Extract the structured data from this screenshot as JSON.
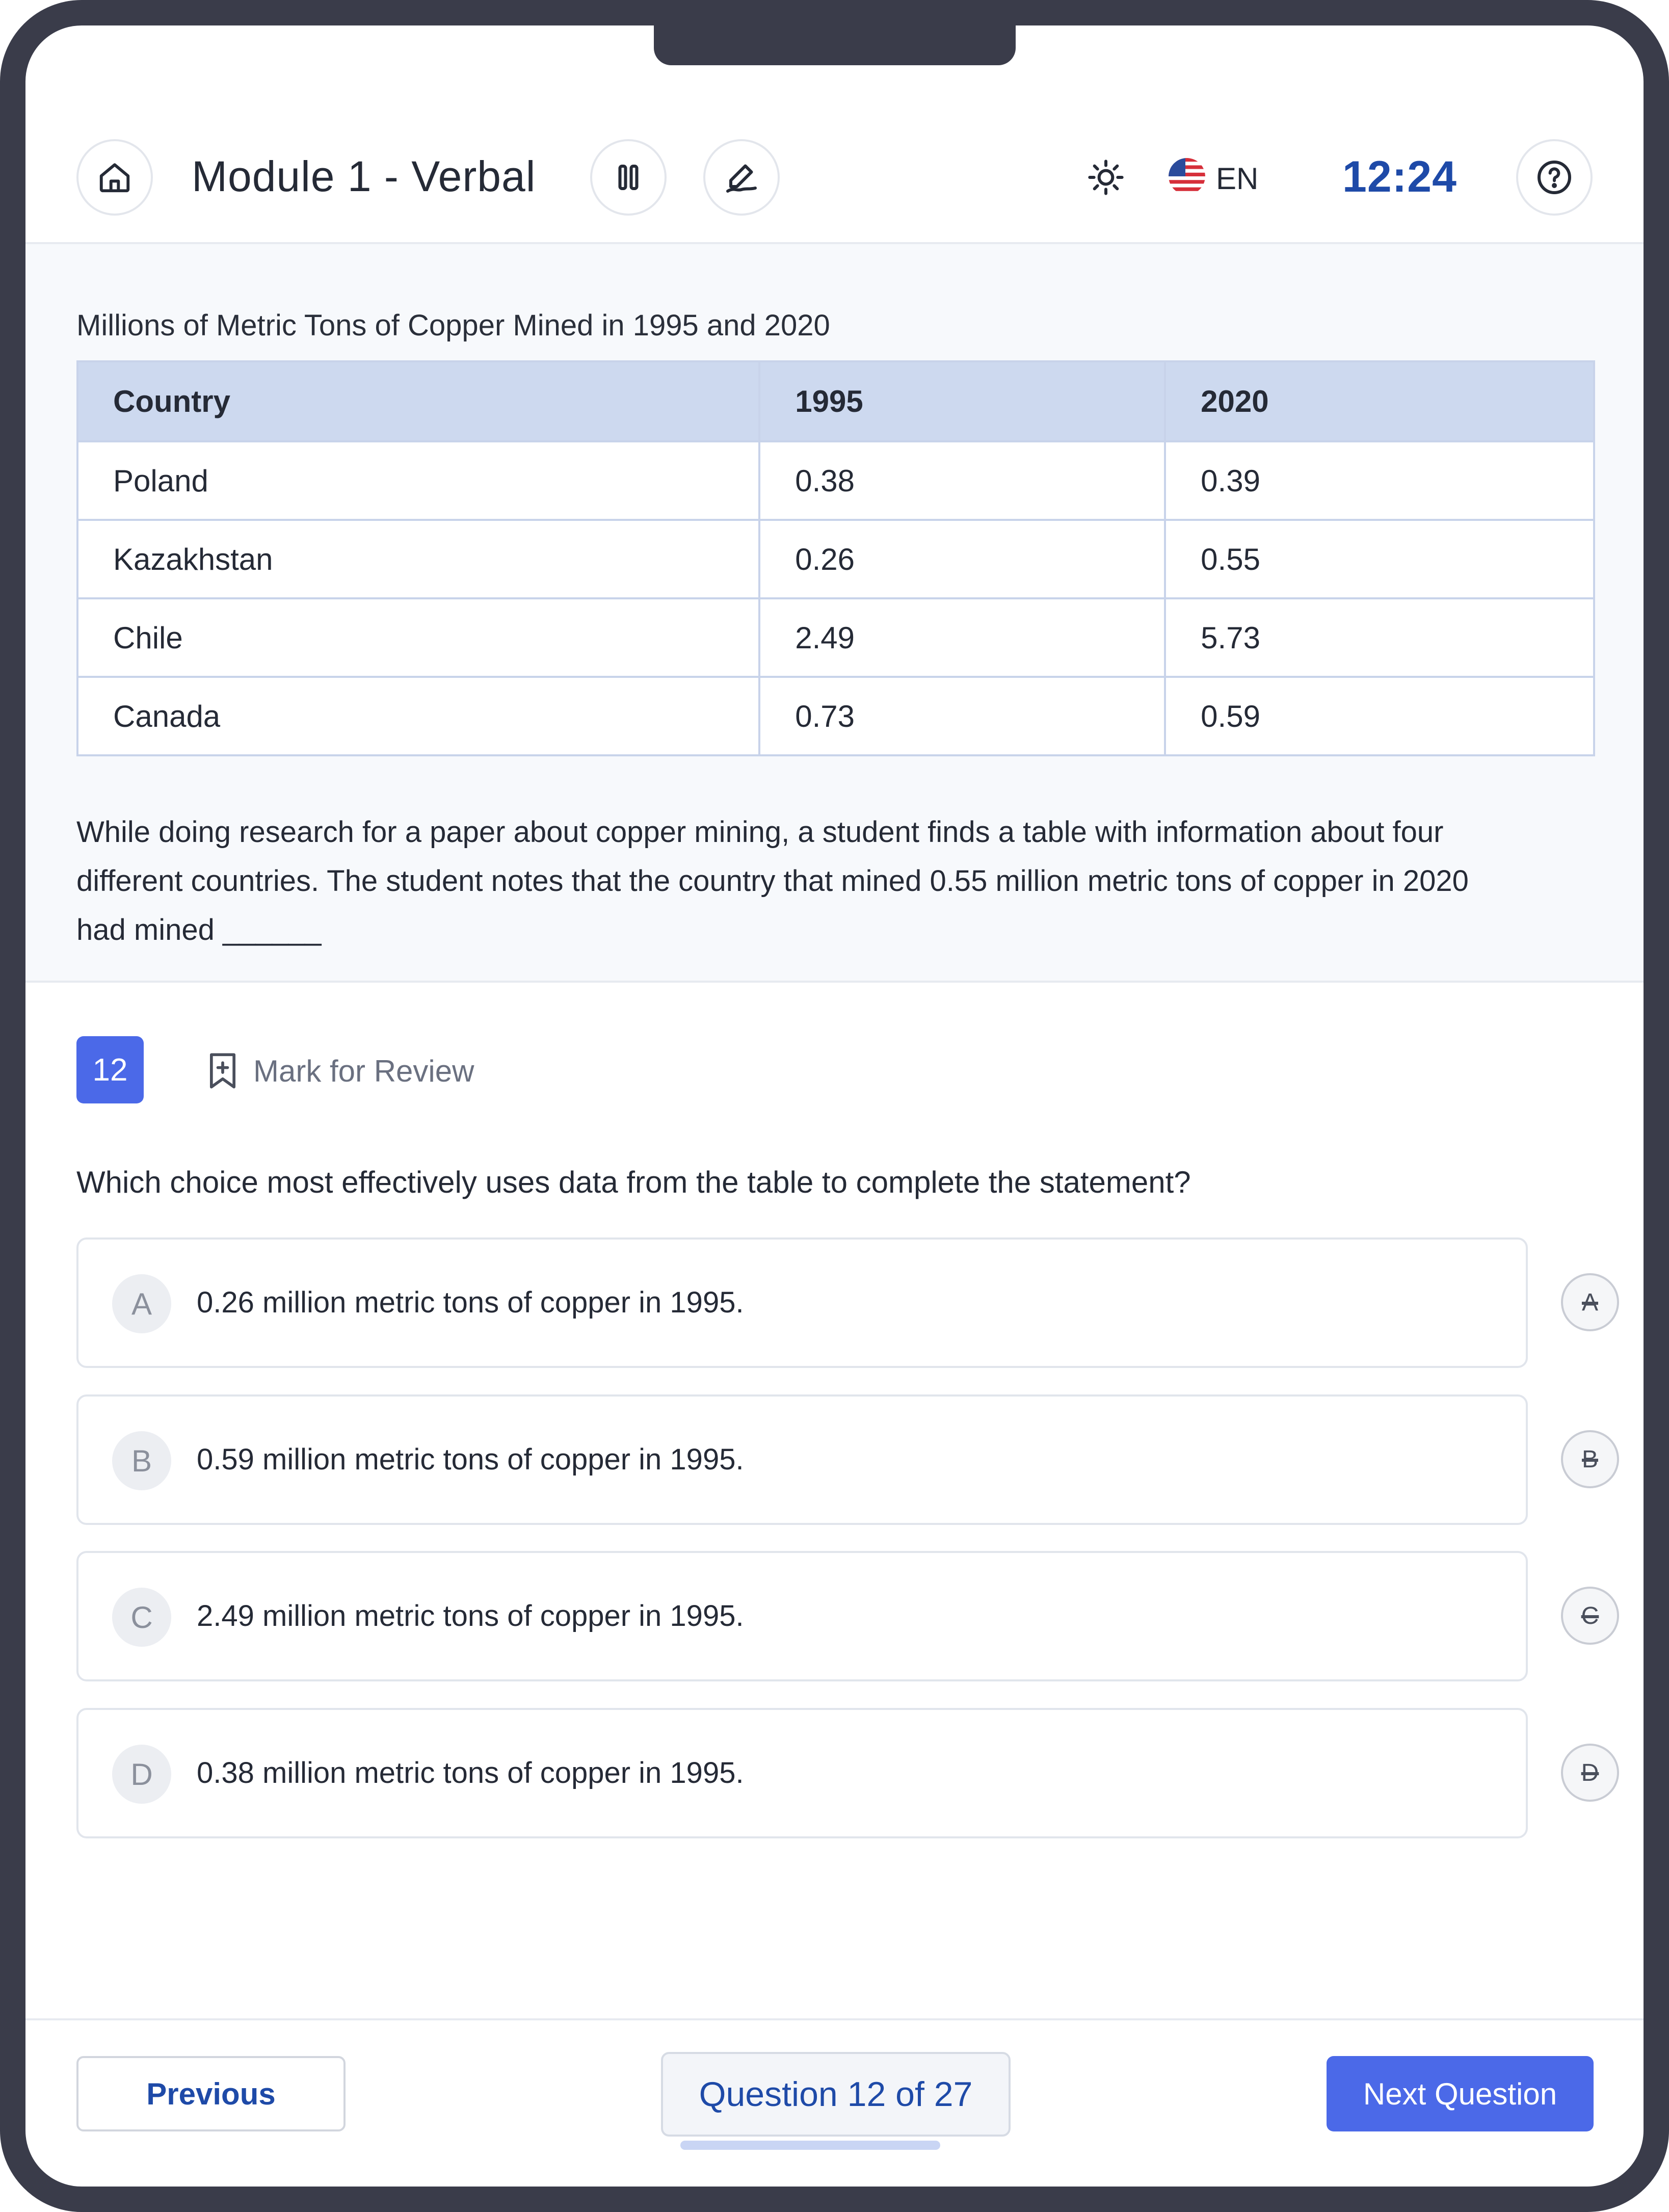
{
  "header": {
    "module_title": "Module 1 - Verbal",
    "language": "EN",
    "timer": "12:24",
    "icons": [
      "home-icon",
      "pause-icon",
      "annotate-icon",
      "brightness-icon",
      "us-flag-icon",
      "help-icon"
    ]
  },
  "passage": {
    "table_caption": "Millions of Metric Tons of Copper Mined in 1995 and 2020",
    "table": {
      "headers": [
        "Country",
        "1995",
        "2020"
      ],
      "rows": [
        [
          "Poland",
          "0.38",
          "0.39"
        ],
        [
          "Kazakhstan",
          "0.26",
          "0.55"
        ],
        [
          "Chile",
          "2.49",
          "5.73"
        ],
        [
          "Canada",
          "0.73",
          "0.59"
        ]
      ]
    },
    "text_line1": "While doing research for a paper about copper mining, a student finds a table with information about four",
    "text_line2": "different countries. The student notes that the country that mined 0.55 million metric tons of copper in 2020",
    "text_line3": "had mined ______"
  },
  "question": {
    "number": "12",
    "mark_for_review": "Mark for Review",
    "prompt": "Which choice most effectively uses data from the table to complete the statement?",
    "choices": [
      {
        "letter": "A",
        "text": "0.26 million metric tons of copper in 1995."
      },
      {
        "letter": "B",
        "text": "0.59 million metric tons of copper in 1995."
      },
      {
        "letter": "C",
        "text": "2.49 million metric tons of copper in 1995."
      },
      {
        "letter": "D",
        "text": "0.38 million metric tons of copper in 1995."
      }
    ]
  },
  "footer": {
    "previous_label": "Previous",
    "progress_label": "Question 12 of 27",
    "next_label": "Next Question"
  },
  "colors": {
    "accent": "#4b69e8",
    "timer": "#1e4aa8",
    "table_header": "#cdd9ef",
    "bezel": "#3a3c4a"
  }
}
